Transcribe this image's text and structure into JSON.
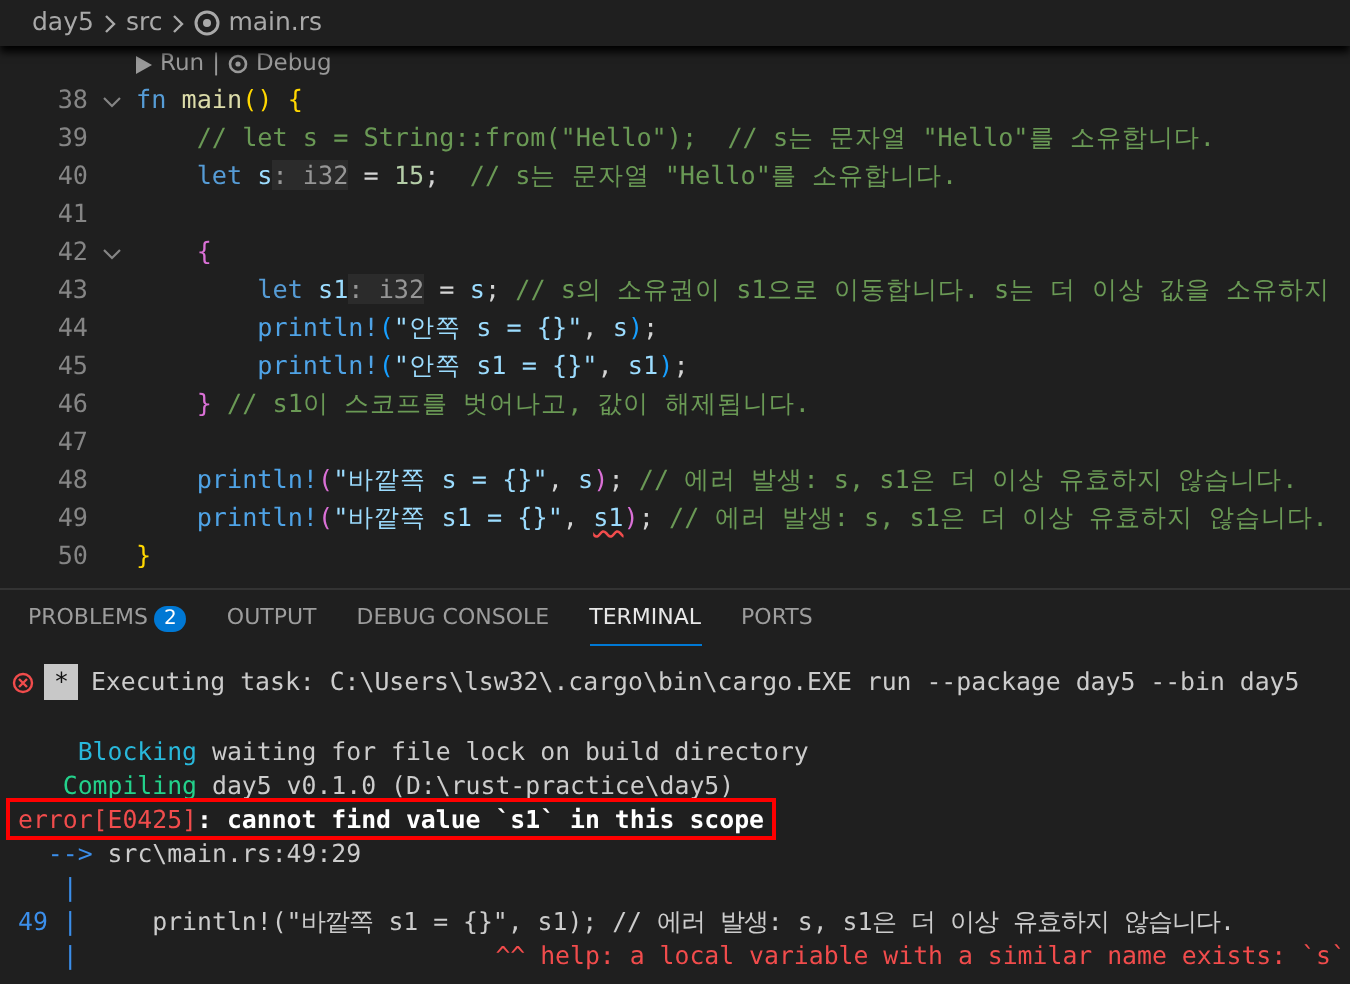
{
  "breadcrumb": [
    "day5",
    "src",
    "main.rs"
  ],
  "codelens": {
    "run": "Run",
    "separator": "|",
    "debug": "Debug"
  },
  "code_lines": [
    {
      "number": "38",
      "foldable": true,
      "tokens": [
        {
          "kind": "kw",
          "text": "fn "
        },
        {
          "kind": "fn",
          "text": "main"
        },
        {
          "kind": "b1",
          "text": "() {"
        }
      ]
    },
    {
      "number": "39",
      "foldable": false,
      "tokens": [
        {
          "kind": "cmt",
          "text": "    // let s = String::from(\"Hello\");  // s는 문자열 \"Hello\"를 소유합니다."
        }
      ]
    },
    {
      "number": "40",
      "foldable": false,
      "tokens": [
        {
          "kind": "kw",
          "text": "    let "
        },
        {
          "kind": "var",
          "text": "s"
        },
        {
          "kind": "hint",
          "text": ": i32"
        },
        {
          "kind": "plain",
          "text": " = "
        },
        {
          "kind": "num",
          "text": "15"
        },
        {
          "kind": "plain",
          "text": ";  "
        },
        {
          "kind": "cmt",
          "text": "// s는 문자열 \"Hello\"를 소유합니다."
        }
      ]
    },
    {
      "number": "41",
      "foldable": false
    },
    {
      "number": "42",
      "foldable": true,
      "tokens": [
        {
          "kind": "b2",
          "text": "    {"
        }
      ]
    },
    {
      "number": "43",
      "foldable": false,
      "tokens": [
        {
          "kind": "kw",
          "text": "        let "
        },
        {
          "kind": "var",
          "text": "s1"
        },
        {
          "kind": "hint",
          "text": ": i32"
        },
        {
          "kind": "plain",
          "text": " = "
        },
        {
          "kind": "var",
          "text": "s"
        },
        {
          "kind": "plain",
          "text": "; "
        },
        {
          "kind": "cmt",
          "text": "// s의 소유권이 s1으로 이동합니다. s는 더 이상 값을 소유하지"
        }
      ]
    },
    {
      "number": "44",
      "foldable": false,
      "tokens": [
        {
          "kind": "macro",
          "text": "        println!"
        },
        {
          "kind": "b3",
          "text": "("
        },
        {
          "kind": "str",
          "text": "\"안쪽 s = {}\""
        },
        {
          "kind": "plain",
          "text": ", "
        },
        {
          "kind": "var",
          "text": "s"
        },
        {
          "kind": "b3",
          "text": ")"
        },
        {
          "kind": "plain",
          "text": ";"
        }
      ]
    },
    {
      "number": "45",
      "foldable": false,
      "tokens": [
        {
          "kind": "macro",
          "text": "        println!"
        },
        {
          "kind": "b3",
          "text": "("
        },
        {
          "kind": "str",
          "text": "\"안쪽 s1 = {}\""
        },
        {
          "kind": "plain",
          "text": ", "
        },
        {
          "kind": "var",
          "text": "s1"
        },
        {
          "kind": "b3",
          "text": ")"
        },
        {
          "kind": "plain",
          "text": ";"
        }
      ]
    },
    {
      "number": "46",
      "foldable": false,
      "tokens": [
        {
          "kind": "b2",
          "text": "    } "
        },
        {
          "kind": "cmt",
          "text": "// s1이 스코프를 벗어나고, 값이 해제됩니다."
        }
      ]
    },
    {
      "number": "47",
      "foldable": false
    },
    {
      "number": "48",
      "foldable": false,
      "tokens": [
        {
          "kind": "macro",
          "text": "    println!"
        },
        {
          "kind": "b2",
          "text": "("
        },
        {
          "kind": "str",
          "text": "\"바깥쪽 s = {}\""
        },
        {
          "kind": "plain",
          "text": ", "
        },
        {
          "kind": "var",
          "text": "s"
        },
        {
          "kind": "b2",
          "text": ")"
        },
        {
          "kind": "plain",
          "text": "; "
        },
        {
          "kind": "cmt",
          "text": "// 에러 발생: s, s1은 더 이상 유효하지 않습니다."
        }
      ]
    },
    {
      "number": "49",
      "foldable": false,
      "tokens": [
        {
          "kind": "macro",
          "text": "    println!"
        },
        {
          "kind": "b2",
          "text": "("
        },
        {
          "kind": "str",
          "text": "\"바깥쪽 s1 = {}\""
        },
        {
          "kind": "plain",
          "text": ", "
        },
        {
          "kind": "err",
          "text": "s1"
        },
        {
          "kind": "b2",
          "text": ")"
        },
        {
          "kind": "plain",
          "text": "; "
        },
        {
          "kind": "cmt",
          "text": "// 에러 발생: s, s1은 더 이상 유효하지 않습니다."
        }
      ]
    },
    {
      "number": "50",
      "foldable": false,
      "tokens": [
        {
          "kind": "b1",
          "text": "}"
        }
      ]
    }
  ],
  "panel_tabs": [
    {
      "label": "PROBLEMS",
      "badge": "2",
      "selected": false
    },
    {
      "label": "OUTPUT",
      "selected": false
    },
    {
      "label": "DEBUG CONSOLE",
      "selected": false
    },
    {
      "label": "TERMINAL",
      "selected": true
    },
    {
      "label": "PORTS",
      "selected": false
    }
  ],
  "terminal": {
    "task": {
      "marker": "*",
      "text": "Executing task: C:\\Users\\lsw32\\.cargo\\bin\\cargo.EXE run --package day5 --bin day5"
    },
    "lines": [
      {
        "highlighted": false
      },
      {
        "highlighted": false,
        "segments": [
          {
            "kind": "cyan",
            "text": "    Blocking"
          },
          {
            "kind": "plain",
            "text": " waiting for file lock on build directory"
          }
        ]
      },
      {
        "highlighted": false,
        "segments": [
          {
            "kind": "green",
            "text": "   Compiling"
          },
          {
            "kind": "plain",
            "text": " day5 v0.1.0 (D:\\rust-practice\\day5)"
          }
        ]
      },
      {
        "highlighted": true,
        "segments": [
          {
            "kind": "red",
            "text": "error[E0425]"
          },
          {
            "kind": "bold",
            "text": ": cannot find value `s1` in this scope"
          }
        ]
      },
      {
        "highlighted": false,
        "segments": [
          {
            "kind": "blue",
            "text": "  -->"
          },
          {
            "kind": "plain",
            "text": " src\\main.rs:49:29"
          }
        ]
      },
      {
        "highlighted": false,
        "segments": [
          {
            "kind": "blue",
            "text": "   |"
          }
        ]
      },
      {
        "highlighted": false,
        "segments": [
          {
            "kind": "blue",
            "text": "49 |"
          },
          {
            "kind": "plain",
            "text": "     println!(\"바깥쪽 s1 = {}\", s1); // 에러 발생: s, s1은 더 이상 유효하지 않습니다."
          }
        ]
      },
      {
        "highlighted": false,
        "segments": [
          {
            "kind": "blue",
            "text": "   |"
          },
          {
            "kind": "red",
            "text": "                            ^^ help: a local variable with a similar name exists: `s`"
          }
        ]
      }
    ]
  }
}
